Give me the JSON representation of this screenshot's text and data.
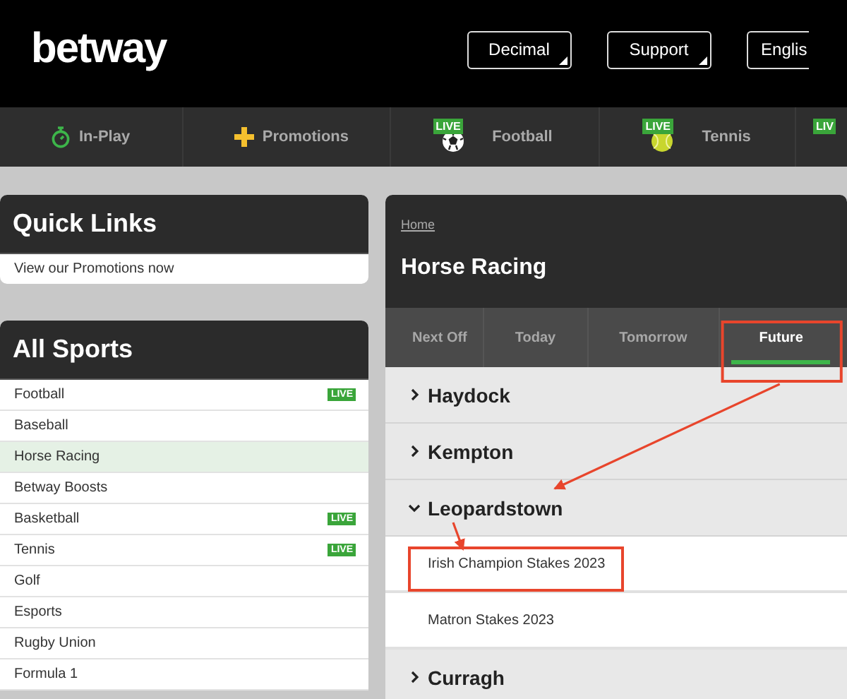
{
  "header": {
    "logo": "betway",
    "buttons": [
      {
        "label": "Decimal",
        "dropdown": true
      },
      {
        "label": "Support",
        "dropdown": true
      },
      {
        "label": "Englis",
        "dropdown": false
      }
    ]
  },
  "nav": [
    {
      "label": "In-Play"
    },
    {
      "label": "Promotions"
    },
    {
      "label": "Football",
      "badge": "LIVE"
    },
    {
      "label": "Tennis",
      "badge": "LIVE"
    },
    {
      "badge": "LIV"
    }
  ],
  "quick_links": {
    "title": "Quick Links",
    "items": [
      "View our Promotions now"
    ]
  },
  "all_sports": {
    "title": "All Sports",
    "items": [
      {
        "label": "Football",
        "badge": "LIVE",
        "selected": false
      },
      {
        "label": "Baseball",
        "selected": false
      },
      {
        "label": "Horse Racing",
        "selected": true
      },
      {
        "label": "Betway Boosts",
        "selected": false
      },
      {
        "label": "Basketball",
        "badge": "LIVE",
        "selected": false
      },
      {
        "label": "Tennis",
        "badge": "LIVE",
        "selected": false
      },
      {
        "label": "Golf",
        "selected": false
      },
      {
        "label": "Esports",
        "selected": false
      },
      {
        "label": "Rugby Union",
        "selected": false
      },
      {
        "label": "Formula 1",
        "selected": false
      }
    ]
  },
  "racing": {
    "breadcrumb": "Home",
    "title": "Horse Racing",
    "tabs": [
      {
        "label": "Next Off",
        "selected": false,
        "highlighted": false
      },
      {
        "label": "Today",
        "selected": false,
        "highlighted": false
      },
      {
        "label": "Tomorrow",
        "selected": false,
        "highlighted": false
      },
      {
        "label": "Future",
        "selected": true,
        "highlighted": true
      }
    ],
    "meetings": [
      {
        "name": "Haydock",
        "expanded": false
      },
      {
        "name": "Kempton",
        "expanded": false
      },
      {
        "name": "Leopardstown",
        "expanded": true,
        "events": [
          {
            "name": "Irish Champion Stakes 2023",
            "highlighted": true
          },
          {
            "name": "Matron Stakes 2023",
            "highlighted": false
          }
        ]
      },
      {
        "name": "Curragh",
        "expanded": false
      }
    ]
  }
}
